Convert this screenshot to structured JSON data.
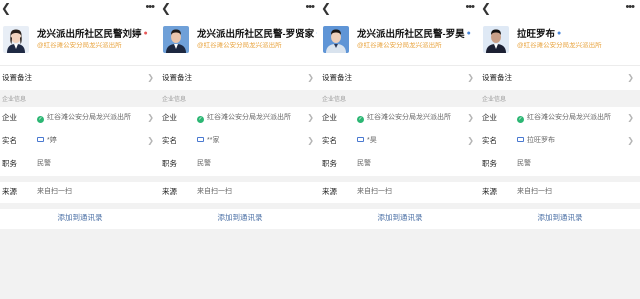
{
  "panels": [
    {
      "name": "龙兴派出所社区民警刘婷",
      "gender_icon": "female-icon",
      "gender_color": "#e85a5a",
      "org": "@红谷滩公安分局龙兴派出所",
      "remark_label": "设置备注",
      "section_title": "企业信息",
      "company_label": "企业",
      "company_value": "红谷滩公安分局龙兴派出所",
      "realname_label": "实名",
      "realname_value": "*婷",
      "position_label": "职务",
      "position_value": "民警",
      "source_label": "来源",
      "source_value": "来自扫一扫",
      "add_label": "添加到通讯录",
      "avatar_variant": "female"
    },
    {
      "name": "龙兴派出所社区民警-罗贤家",
      "gender_icon": "male-icon",
      "gender_color": "#4a86d8",
      "org": "@红谷滩公安分局龙兴派出所",
      "remark_label": "设置备注",
      "section_title": "企业信息",
      "company_label": "企业",
      "company_value": "红谷滩公安分局龙兴派出所",
      "realname_label": "实名",
      "realname_value": "**家",
      "position_label": "职务",
      "position_value": "民警",
      "source_label": "来源",
      "source_value": "来自扫一扫",
      "add_label": "添加到通讯录",
      "avatar_variant": "male"
    },
    {
      "name": "龙兴派出所社区民警-罗昊",
      "gender_icon": "male-icon",
      "gender_color": "#4a86d8",
      "org": "@红谷滩公安分局龙兴派出所",
      "remark_label": "设置备注",
      "section_title": "企业信息",
      "company_label": "企业",
      "company_value": "红谷滩公安分局龙兴派出所",
      "realname_label": "实名",
      "realname_value": "*昊",
      "position_label": "职务",
      "position_value": "民警",
      "source_label": "来源",
      "source_value": "来自扫一扫",
      "add_label": "添加到通讯录",
      "avatar_variant": "male"
    },
    {
      "name": "拉旺罗布",
      "gender_icon": "male-icon",
      "gender_color": "#4a86d8",
      "org": "@红谷滩公安分局龙兴派出所",
      "remark_label": "设置备注",
      "section_title": "企业信息",
      "company_label": "企业",
      "company_value": "红谷滩公安分局龙兴派出所",
      "realname_label": "实名",
      "realname_value": "拉旺罗布",
      "position_label": "职务",
      "position_value": "民警",
      "source_label": "来源",
      "source_value": "来自扫一扫",
      "add_label": "添加到通讯录",
      "avatar_variant": "male"
    }
  ],
  "colors": {
    "org_text": "#e8a33d",
    "verified_green": "#2bb673",
    "link_blue": "#4a6fa5",
    "band_gray": "#f2f2f2"
  }
}
